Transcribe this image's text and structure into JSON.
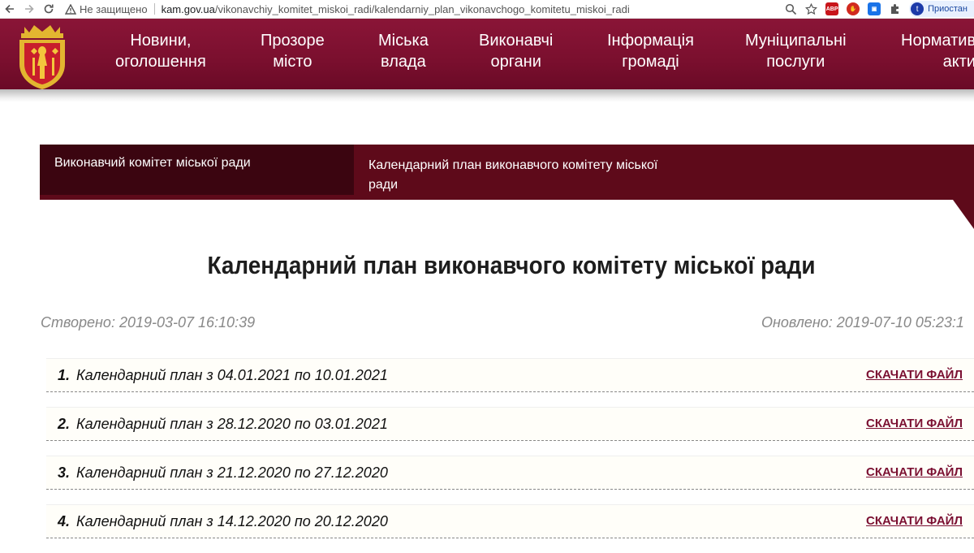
{
  "browser": {
    "security_label": "Не защищено",
    "url_host": "kam.gov.ua",
    "url_path": "/vikonavchiy_komitet_miskoi_radi/kalendarniy_plan_vikonavchogo_komitetu_miskoi_radi",
    "profile_initial": "t",
    "profile_label": "Приостан"
  },
  "nav": [
    {
      "line1": "Новини,",
      "line2": "оголошення"
    },
    {
      "line1": "Прозоре",
      "line2": "місто"
    },
    {
      "line1": "Міська",
      "line2": "влада"
    },
    {
      "line1": "Виконавчі",
      "line2": "органи"
    },
    {
      "line1": "Інформація",
      "line2": "громаді"
    },
    {
      "line1": "Муніципальні",
      "line2": "послуги"
    },
    {
      "line1": "Норматив",
      "line2": "акти"
    }
  ],
  "breadcrumb": {
    "first": "Виконавчий комітет міської ради",
    "second": "Календарний план виконавчого комітету міської ради"
  },
  "page": {
    "title": "Календарний план виконавчого комітету міської ради",
    "created": "Створено: 2019-03-07 16:10:39",
    "updated": "Оновлено: 2019-07-10 05:23:1"
  },
  "documents": [
    {
      "num": "1.",
      "title": "Календарний план з 04.01.2021 по 10.01.2021",
      "link": "СКАЧАТИ ФАЙЛ"
    },
    {
      "num": "2.",
      "title": "Календарний план з 28.12.2020 по 03.01.2021",
      "link": "СКАЧАТИ ФАЙЛ"
    },
    {
      "num": "3.",
      "title": "Календарний план з 21.12.2020 по 27.12.2020",
      "link": "СКАЧАТИ ФАЙЛ"
    },
    {
      "num": "4.",
      "title": "Календарний план з 14.12.2020 по 20.12.2020",
      "link": "СКАЧАТИ ФАЙЛ"
    }
  ],
  "colors": {
    "brand": "#7a0f2e",
    "crumb_dark": "#3b0510",
    "crumb_band": "#5e0a1a",
    "link": "#7b1032"
  }
}
